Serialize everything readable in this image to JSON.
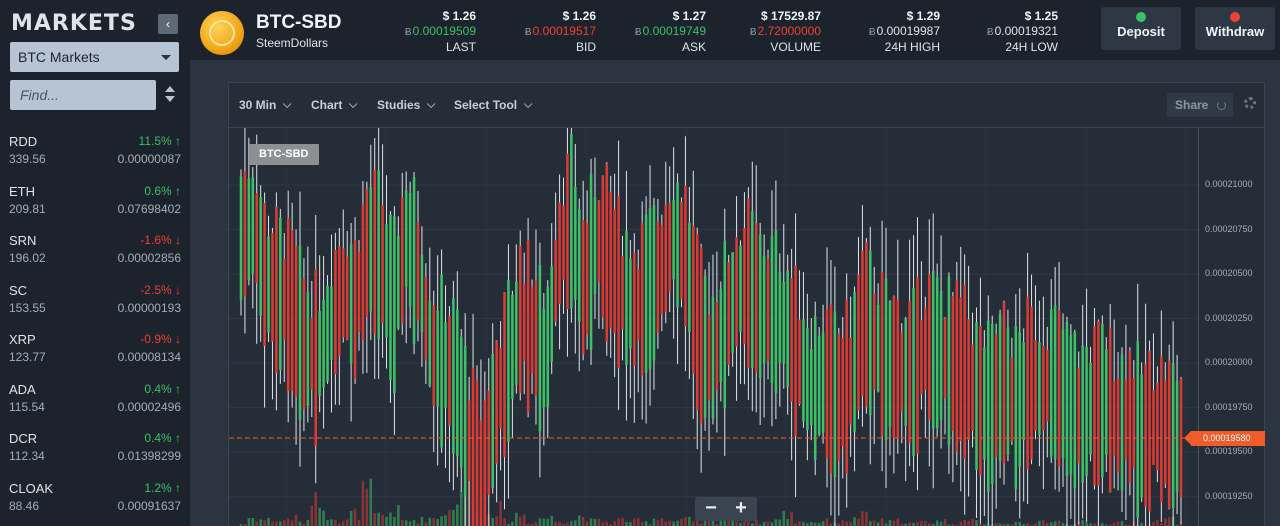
{
  "sidebar": {
    "title": "MARKETS",
    "collapse_icon": "chevron-left-icon",
    "market_select": "BTC Markets",
    "search_placeholder": "Find...",
    "markets": [
      {
        "symbol": "RDD",
        "change": "11.5% ↑",
        "dir": "up",
        "volume": "339.56",
        "price": "0.00000087"
      },
      {
        "symbol": "ETH",
        "change": "0.6% ↑",
        "dir": "up",
        "volume": "209.81",
        "price": "0.07698402"
      },
      {
        "symbol": "SRN",
        "change": "-1.6% ↓",
        "dir": "down",
        "volume": "196.02",
        "price": "0.00002856"
      },
      {
        "symbol": "SC",
        "change": "-2.5% ↓",
        "dir": "down",
        "volume": "153.55",
        "price": "0.00000193"
      },
      {
        "symbol": "XRP",
        "change": "-0.9% ↓",
        "dir": "down",
        "volume": "123.77",
        "price": "0.00008134"
      },
      {
        "symbol": "ADA",
        "change": "0.4% ↑",
        "dir": "up",
        "volume": "115.54",
        "price": "0.00002496"
      },
      {
        "symbol": "DCR",
        "change": "0.4% ↑",
        "dir": "up",
        "volume": "112.34",
        "price": "0.01398299"
      },
      {
        "symbol": "CLOAK",
        "change": "1.2% ↑",
        "dir": "up",
        "volume": "88.46",
        "price": "0.00091637"
      }
    ]
  },
  "header": {
    "pair": "BTC-SBD",
    "coin_name": "SteemDollars",
    "btc_symbol": "Ƀ",
    "stats": [
      {
        "usd": "$ 1.26",
        "btc": "0.00019509",
        "color": "green",
        "label": "LAST"
      },
      {
        "usd": "$ 1.26",
        "btc": "0.00019517",
        "color": "red",
        "label": "BID"
      },
      {
        "usd": "$ 1.27",
        "btc": "0.00019749",
        "color": "green",
        "label": "ASK"
      },
      {
        "usd": "$ 17529.87",
        "btc": "2.72000000",
        "color": "red",
        "label": "VOLUME"
      },
      {
        "usd": "$ 1.29",
        "btc": "0.00019987",
        "color": "plain",
        "label": "24H HIGH"
      },
      {
        "usd": "$ 1.25",
        "btc": "0.00019321",
        "color": "plain",
        "label": "24H LOW"
      }
    ],
    "deposit_label": "Deposit",
    "withdraw_label": "Withdraw",
    "deposit_color": "#3cc068",
    "withdraw_color": "#ef4036"
  },
  "chart_toolbar": {
    "interval": "30 Min",
    "chart": "Chart",
    "studies": "Studies",
    "select_tool": "Select Tool",
    "share": "Share"
  },
  "chart_data": {
    "type": "candlestick",
    "pair_label": "BTC-SBD",
    "ylim": [
      0.0001908,
      0.0002132
    ],
    "yticks": [
      "0.00021000",
      "0.00020750",
      "0.00020500",
      "0.00020250",
      "0.00020000",
      "0.00019750",
      "0.00019500",
      "0.00019250"
    ],
    "current_price": "0.00019580",
    "up_color": "#3cc068",
    "down_color": "#d93b35",
    "anchors": [
      0.000207,
      0.0002078,
      0.0002045,
      0.000204,
      0.000203,
      0.000201,
      0.0002002,
      0.000202,
      0.000204,
      0.000203,
      0.0002065,
      0.000206,
      0.000203,
      0.000207,
      0.000205,
      0.0002005,
      0.0002,
      0.000199,
      0.0001955,
      0.0001935,
      0.0001975,
      0.0002,
      0.0002025,
      0.0002018,
      0.0002,
      0.000206,
      0.000208,
      0.000204,
      0.000207,
      0.000206,
      0.000204,
      0.000203,
      0.000204,
      0.000205,
      0.000207,
      0.000206,
      0.000202,
      0.0002,
      0.000202,
      0.000204,
      0.0002045,
      0.000203,
      0.000203,
      0.000202,
      0.0002,
      0.0001985,
      0.000199,
      0.000198,
      0.000199,
      0.0002025,
      0.000201,
      0.0002,
      0.0001995,
      0.0001995,
      0.000201,
      0.0002005,
      0.0002,
      0.0001995,
      0.000198,
      0.0001975,
      0.000199,
      0.0001975,
      0.000199,
      0.0001985,
      0.000199,
      0.000198,
      0.000197,
      0.0001975,
      0.000198,
      0.0001965,
      0.000197,
      0.0001958,
      0.0001965,
      0.000196,
      0.0001958
    ],
    "volumes": [
      0.05,
      0.15,
      0.12,
      0.1,
      0.15,
      0.08,
      0.6,
      0.2,
      0.1,
      0.22,
      0.55,
      0.18,
      0.25,
      0.1,
      0.12,
      0.15,
      0.25,
      0.45,
      0.75,
      0.35,
      0.3,
      0.1,
      0.2,
      0.08,
      0.15,
      0.1,
      0.12,
      0.18,
      0.1,
      0.08,
      0.12,
      0.1,
      0.08,
      0.15,
      0.1,
      0.12,
      0.08,
      0.1,
      0.18,
      0.12,
      0.1,
      0.08,
      0.12,
      0.2,
      0.1,
      0.08,
      0.1,
      0.08,
      0.12,
      0.18,
      0.1,
      0.08,
      0.1,
      0.06,
      0.08,
      0.1,
      0.06,
      0.08,
      0.1,
      0.06,
      0.08,
      0.06,
      0.05,
      0.1,
      0.08,
      0.06,
      0.08,
      0.05,
      0.06,
      0.08,
      0.06,
      0.05,
      0.08,
      0.12,
      0.06
    ]
  }
}
